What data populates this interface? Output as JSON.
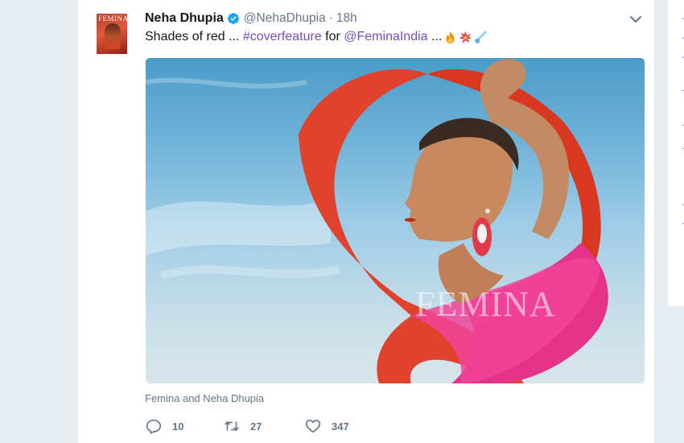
{
  "tweet": {
    "author_name": "Neha Dhupia",
    "handle": "@NehaDhupia",
    "separator": "·",
    "time": "18h",
    "text_prefix": "Shades of red ... ",
    "hashtag": "#coverfeature",
    "text_mid": " for ",
    "mention": "@FeminaIndia",
    "text_suffix": " ...",
    "emojis": [
      "fire-emoji",
      "collision-emoji",
      "comet-emoji"
    ],
    "avatar_mast": "FEMINA",
    "media_watermark": "FEMINA",
    "media_caption": "Femina and Neha Dhupia",
    "actions": {
      "replies": "10",
      "retweets": "27",
      "likes": "347"
    }
  },
  "colors": {
    "link": "#794bc4",
    "text": "#14171a",
    "muted": "#657786",
    "verified": "#1da1f2",
    "background": "#e6ecf0"
  }
}
